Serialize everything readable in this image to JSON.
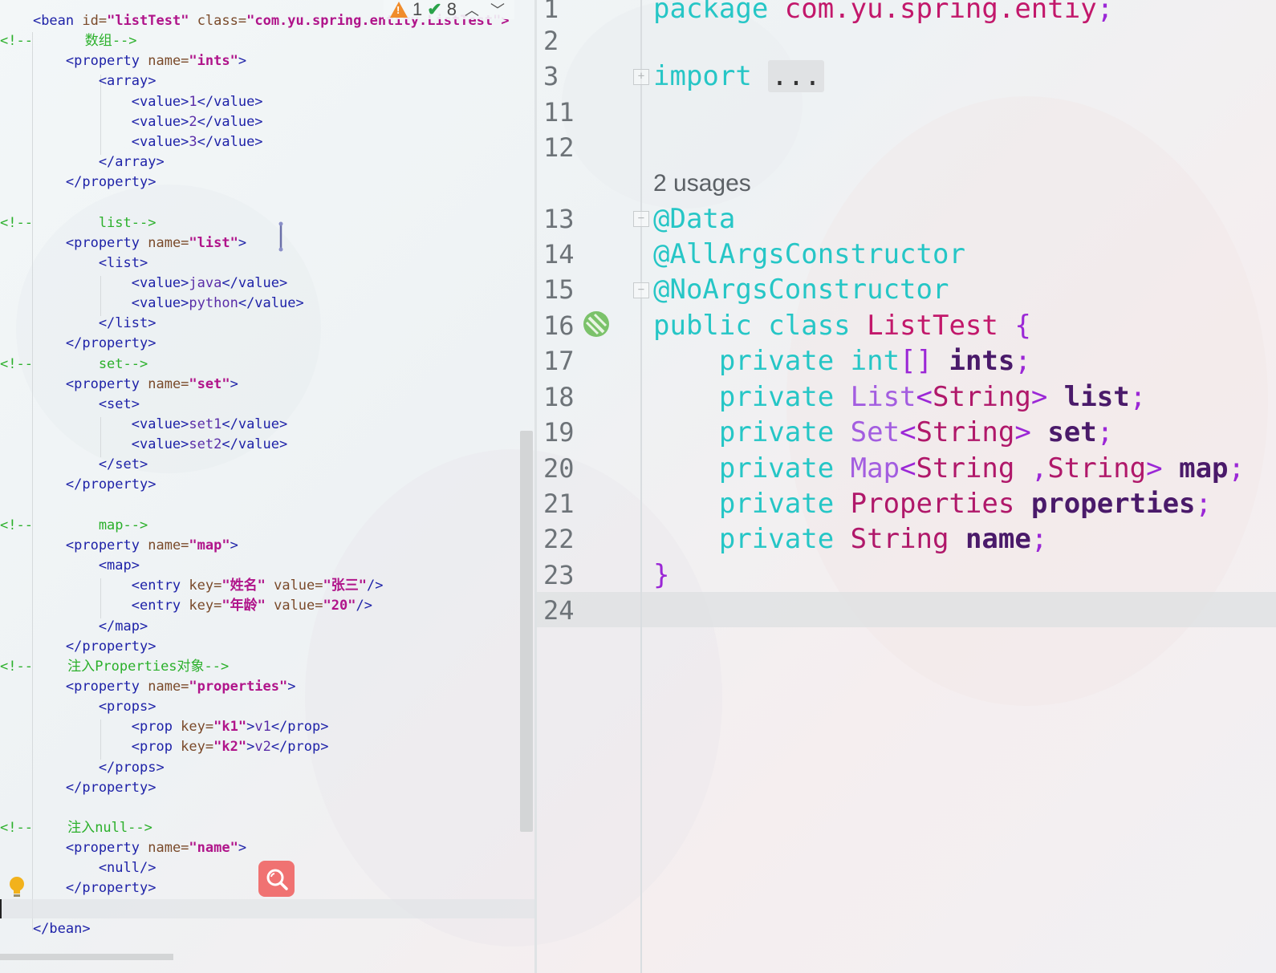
{
  "left_editor": {
    "inspections": {
      "warnings": "1",
      "weak_warnings": "8",
      "prev": "^",
      "next": "v"
    },
    "lines": [
      [
        {
          "c": "tag",
          "t": "<bean "
        },
        {
          "c": "attr",
          "t": "id="
        },
        {
          "c": "aval",
          "t": "\"listTest\" "
        },
        {
          "c": "attr",
          "t": "class="
        },
        {
          "c": "aval",
          "t": "\"com.yu.spring.entity.ListTest\">"
        }
      ],
      [
        {
          "c": "cmt",
          "t": "<!--"
        },
        {
          "c": "cmt-serif",
          "t": "            数组"
        },
        {
          "c": "cmt",
          "t": "-->"
        }
      ],
      [
        {
          "c": "tag",
          "t": "        <property "
        },
        {
          "c": "attr",
          "t": "name="
        },
        {
          "c": "aval",
          "t": "\"ints\""
        },
        {
          "c": "tag",
          "t": ">"
        }
      ],
      [
        {
          "c": "tag",
          "t": "            <array>"
        }
      ],
      [
        {
          "c": "tag",
          "t": "                <value>"
        },
        {
          "c": "txt",
          "t": "1"
        },
        {
          "c": "tag",
          "t": "</value>"
        }
      ],
      [
        {
          "c": "tag",
          "t": "                <value>"
        },
        {
          "c": "txt",
          "t": "2"
        },
        {
          "c": "tag",
          "t": "</value>"
        }
      ],
      [
        {
          "c": "tag",
          "t": "                <value>"
        },
        {
          "c": "txt",
          "t": "3"
        },
        {
          "c": "tag",
          "t": "</value>"
        }
      ],
      [
        {
          "c": "tag",
          "t": "            </array>"
        }
      ],
      [
        {
          "c": "tag",
          "t": "        </property>"
        }
      ],
      [],
      [
        {
          "c": "cmt",
          "t": "<!--        list-->"
        }
      ],
      [
        {
          "c": "tag",
          "t": "        <property "
        },
        {
          "c": "attr",
          "t": "name="
        },
        {
          "c": "aval",
          "t": "\"list\""
        },
        {
          "c": "tag",
          "t": ">"
        }
      ],
      [
        {
          "c": "tag",
          "t": "            <list>"
        }
      ],
      [
        {
          "c": "tag",
          "t": "                <value>"
        },
        {
          "c": "txt",
          "t": "java"
        },
        {
          "c": "tag",
          "t": "</value>"
        }
      ],
      [
        {
          "c": "tag",
          "t": "                <value>"
        },
        {
          "c": "txt",
          "t": "python"
        },
        {
          "c": "tag",
          "t": "</value>"
        }
      ],
      [
        {
          "c": "tag",
          "t": "            </list>"
        }
      ],
      [
        {
          "c": "tag",
          "t": "        </property>"
        }
      ],
      [
        {
          "c": "cmt",
          "t": "<!--        set-->"
        }
      ],
      [
        {
          "c": "tag",
          "t": "        <property "
        },
        {
          "c": "attr",
          "t": "name="
        },
        {
          "c": "aval",
          "t": "\"set\""
        },
        {
          "c": "tag",
          "t": ">"
        }
      ],
      [
        {
          "c": "tag",
          "t": "            <set>"
        }
      ],
      [
        {
          "c": "tag",
          "t": "                <value>"
        },
        {
          "c": "txt",
          "t": "set1"
        },
        {
          "c": "tag",
          "t": "</value>"
        }
      ],
      [
        {
          "c": "tag",
          "t": "                <value>"
        },
        {
          "c": "txt",
          "t": "set2"
        },
        {
          "c": "tag",
          "t": "</value>"
        }
      ],
      [
        {
          "c": "tag",
          "t": "            </set>"
        }
      ],
      [
        {
          "c": "tag",
          "t": "        </property>"
        }
      ],
      [],
      [
        {
          "c": "cmt",
          "t": "<!--        map-->"
        }
      ],
      [
        {
          "c": "tag",
          "t": "        <property "
        },
        {
          "c": "attr",
          "t": "name="
        },
        {
          "c": "aval",
          "t": "\"map\""
        },
        {
          "c": "tag",
          "t": ">"
        }
      ],
      [
        {
          "c": "tag",
          "t": "            <map>"
        }
      ],
      [
        {
          "c": "tag",
          "t": "                <entry "
        },
        {
          "c": "attr",
          "t": "key="
        },
        {
          "c": "aval",
          "t": "\""
        },
        {
          "c": "cn-val",
          "t": "姓名"
        },
        {
          "c": "aval",
          "t": "\" "
        },
        {
          "c": "attr",
          "t": "value="
        },
        {
          "c": "aval",
          "t": "\""
        },
        {
          "c": "cn-val",
          "t": "张三"
        },
        {
          "c": "aval",
          "t": "\""
        },
        {
          "c": "tag",
          "t": "/>"
        }
      ],
      [
        {
          "c": "tag",
          "t": "                <entry "
        },
        {
          "c": "attr",
          "t": "key="
        },
        {
          "c": "aval",
          "t": "\""
        },
        {
          "c": "cn-val",
          "t": "年龄"
        },
        {
          "c": "aval",
          "t": "\" "
        },
        {
          "c": "attr",
          "t": "value="
        },
        {
          "c": "aval",
          "t": "\"20\""
        },
        {
          "c": "tag",
          "t": "/>"
        }
      ],
      [
        {
          "c": "tag",
          "t": "            </map>"
        }
      ],
      [
        {
          "c": "tag",
          "t": "        </property>"
        }
      ],
      [
        {
          "c": "cmt",
          "t": "<!--"
        },
        {
          "c": "cmt-serif",
          "t": "        注入"
        },
        {
          "c": "cmt",
          "t": "Properties"
        },
        {
          "c": "cmt-serif",
          "t": "对象"
        },
        {
          "c": "cmt",
          "t": "-->"
        }
      ],
      [
        {
          "c": "tag",
          "t": "        <property "
        },
        {
          "c": "attr",
          "t": "name="
        },
        {
          "c": "aval",
          "t": "\"properties\""
        },
        {
          "c": "tag",
          "t": ">"
        }
      ],
      [
        {
          "c": "tag",
          "t": "            <props>"
        }
      ],
      [
        {
          "c": "tag",
          "t": "                <prop "
        },
        {
          "c": "attr",
          "t": "key="
        },
        {
          "c": "aval",
          "t": "\"k1\""
        },
        {
          "c": "tag",
          "t": ">"
        },
        {
          "c": "txt",
          "t": "v1"
        },
        {
          "c": "tag",
          "t": "</prop>"
        }
      ],
      [
        {
          "c": "tag",
          "t": "                <prop "
        },
        {
          "c": "attr",
          "t": "key="
        },
        {
          "c": "aval",
          "t": "\"k2\""
        },
        {
          "c": "tag",
          "t": ">"
        },
        {
          "c": "txt",
          "t": "v2"
        },
        {
          "c": "tag",
          "t": "</prop>"
        }
      ],
      [
        {
          "c": "tag",
          "t": "            </props>"
        }
      ],
      [
        {
          "c": "tag",
          "t": "        </property>"
        }
      ],
      [],
      [
        {
          "c": "cmt",
          "t": "<!--"
        },
        {
          "c": "cmt-serif",
          "t": "        注入"
        },
        {
          "c": "cmt",
          "t": "null-->"
        }
      ],
      [
        {
          "c": "tag",
          "t": "        <property "
        },
        {
          "c": "attr",
          "t": "name="
        },
        {
          "c": "aval",
          "t": "\"name\""
        },
        {
          "c": "tag",
          "t": ">"
        }
      ],
      [
        {
          "c": "tag",
          "t": "            <null/>"
        }
      ],
      [
        {
          "c": "tag",
          "t": "        </property>"
        }
      ],
      [],
      [
        {
          "c": "tag",
          "t": "    </bean>"
        }
      ]
    ]
  },
  "right_editor": {
    "usages_hint": "2 usages",
    "lines": [
      {
        "num": "1",
        "tokens": [
          {
            "c": "kw",
            "t": "package "
          },
          {
            "c": "pkg",
            "t": "com.yu.spring.entiy"
          },
          {
            "c": "semi",
            "t": ";"
          }
        ]
      },
      {
        "num": "2",
        "tokens": []
      },
      {
        "num": "3",
        "tokens": [
          {
            "c": "kw",
            "t": "import "
          },
          {
            "c": "fold-ell",
            "t": "..."
          }
        ]
      },
      {
        "num": "11",
        "tokens": []
      },
      {
        "num": "12",
        "tokens": []
      },
      {
        "num": "13",
        "tokens": [
          {
            "c": "ann",
            "t": "@Data"
          }
        ]
      },
      {
        "num": "14",
        "tokens": [
          {
            "c": "ann",
            "t": "@AllArgsConstructor"
          }
        ]
      },
      {
        "num": "15",
        "tokens": [
          {
            "c": "ann",
            "t": "@NoArgsConstructor"
          }
        ]
      },
      {
        "num": "16",
        "tokens": [
          {
            "c": "kw",
            "t": "public class "
          },
          {
            "c": "cls",
            "t": "ListTest "
          },
          {
            "c": "brace",
            "t": "{"
          }
        ]
      },
      {
        "num": "17",
        "tokens": [
          {
            "c": "kw",
            "t": "    private int"
          },
          {
            "c": "brace",
            "t": "[] "
          },
          {
            "c": "fld",
            "t": "ints"
          },
          {
            "c": "semi",
            "t": ";"
          }
        ]
      },
      {
        "num": "18",
        "tokens": [
          {
            "c": "kw",
            "t": "    private "
          },
          {
            "c": "gen",
            "t": "List"
          },
          {
            "c": "brace",
            "t": "<"
          },
          {
            "c": "str-t",
            "t": "String"
          },
          {
            "c": "brace",
            "t": "> "
          },
          {
            "c": "fld",
            "t": "list"
          },
          {
            "c": "semi",
            "t": ";"
          }
        ]
      },
      {
        "num": "19",
        "tokens": [
          {
            "c": "kw",
            "t": "    private "
          },
          {
            "c": "gen",
            "t": "Set"
          },
          {
            "c": "brace",
            "t": "<"
          },
          {
            "c": "str-t",
            "t": "String"
          },
          {
            "c": "brace",
            "t": "> "
          },
          {
            "c": "fld",
            "t": "set"
          },
          {
            "c": "semi",
            "t": ";"
          }
        ]
      },
      {
        "num": "20",
        "tokens": [
          {
            "c": "kw",
            "t": "    private "
          },
          {
            "c": "gen",
            "t": "Map"
          },
          {
            "c": "brace",
            "t": "<"
          },
          {
            "c": "str-t",
            "t": "String "
          },
          {
            "c": "brace",
            "t": ","
          },
          {
            "c": "str-t",
            "t": "String"
          },
          {
            "c": "brace",
            "t": "> "
          },
          {
            "c": "fld",
            "t": "map"
          },
          {
            "c": "semi",
            "t": ";"
          }
        ]
      },
      {
        "num": "21",
        "tokens": [
          {
            "c": "kw",
            "t": "    private "
          },
          {
            "c": "str-t",
            "t": "Properties "
          },
          {
            "c": "fld",
            "t": "properties"
          },
          {
            "c": "semi",
            "t": ";"
          }
        ]
      },
      {
        "num": "22",
        "tokens": [
          {
            "c": "kw",
            "t": "    private "
          },
          {
            "c": "str-t",
            "t": "String "
          },
          {
            "c": "fld",
            "t": "name"
          },
          {
            "c": "semi",
            "t": ";"
          }
        ]
      },
      {
        "num": "23",
        "tokens": [
          {
            "c": "brace",
            "t": "}"
          }
        ]
      },
      {
        "num": "24",
        "tokens": []
      }
    ]
  },
  "icons": {
    "warning": "warning-triangle-icon",
    "check": "double-check-icon",
    "bean": "spring-bean-icon",
    "bulb": "lightbulb-icon",
    "search": "search-icon",
    "cursor": "text-cursor-icon"
  },
  "colors": {
    "keyword": "#26c6c6",
    "type": "#c2186b",
    "field": "#4a1a6a",
    "xml_tag": "#1e22a8",
    "xml_attr_value": "#b0148a",
    "comment": "#2bb02b",
    "search_fab": "#f07272"
  }
}
